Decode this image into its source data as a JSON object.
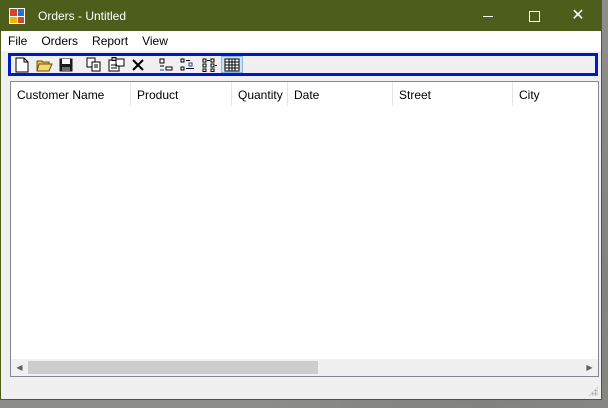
{
  "window": {
    "title": "Orders - Untitled",
    "accent_color": "#4d5e1c",
    "controls": [
      "minimize",
      "maximize",
      "close"
    ]
  },
  "menubar": {
    "items": [
      "File",
      "Orders",
      "Report",
      "View"
    ]
  },
  "toolbar": {
    "highlight_color": "#0019c8",
    "buttons": [
      {
        "icon": "new-document-icon"
      },
      {
        "icon": "open-folder-icon"
      },
      {
        "icon": "save-icon"
      },
      {
        "icon": "copy-icon"
      },
      {
        "icon": "properties-icon"
      },
      {
        "icon": "delete-icon"
      },
      {
        "icon": "large-icons-view-icon"
      },
      {
        "icon": "small-icons-view-icon"
      },
      {
        "icon": "list-view-icon"
      },
      {
        "icon": "details-view-icon",
        "checked": true
      }
    ]
  },
  "listview": {
    "columns": [
      "Customer Name",
      "Product",
      "Quantity",
      "Date",
      "Street",
      "City"
    ],
    "rows": []
  }
}
